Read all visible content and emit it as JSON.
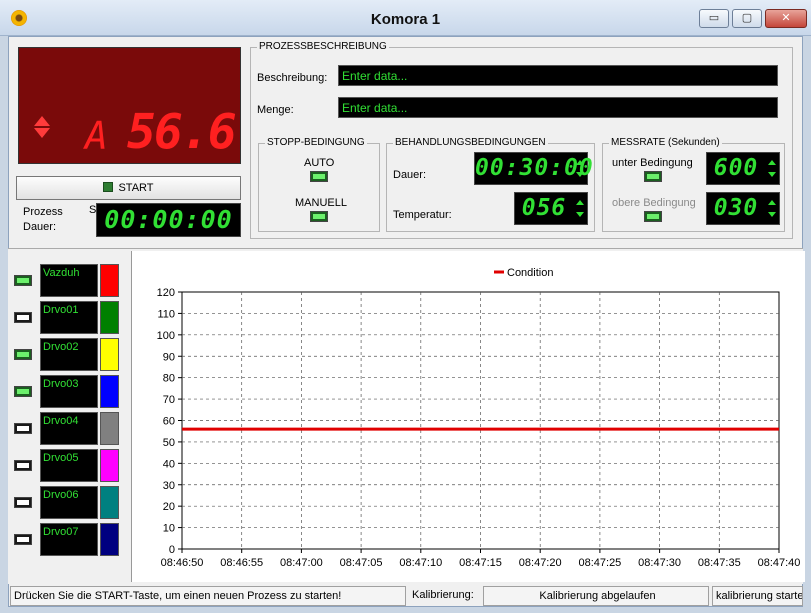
{
  "window": {
    "title": "Komora 1",
    "min_label": "▭",
    "max_label": "▢",
    "close_label": "✕"
  },
  "led": {
    "mode": "A",
    "value": "56.6"
  },
  "start_button": {
    "label": "START"
  },
  "prozess": {
    "label_line1": "Prozess",
    "label_line2": "Dauer:",
    "s_label": "S",
    "time": "00:00:00"
  },
  "prozessbeschreibung": {
    "legend": "PROZESSBESCHREIBUNG",
    "beschreibung_label": "Beschreibung:",
    "beschreibung_placeholder": "Enter data...",
    "menge_label": "Menge:",
    "menge_placeholder": "Enter data..."
  },
  "stopp": {
    "legend": "STOPP-BEDINGUNG",
    "auto_label": "AUTO",
    "manuell_label": "MANUELL"
  },
  "behandlung": {
    "legend": "BEHANDLUNGSBEDINGUNGEN",
    "dauer_label": "Dauer:",
    "dauer_value": "00:30:00",
    "temperatur_label": "Temperatur:",
    "temperatur_value": "056"
  },
  "messrate": {
    "legend": "MESSRATE (Sekunden)",
    "unter_label": "unter Bedingung",
    "unter_value": "600",
    "obere_label": "obere Bedingung",
    "obere_value": "030"
  },
  "series_list": [
    {
      "name": "Vazduh",
      "color": "#ff0000",
      "enabled": true
    },
    {
      "name": "Drvo01",
      "color": "#008000",
      "enabled": false
    },
    {
      "name": "Drvo02",
      "color": "#ffff00",
      "enabled": true
    },
    {
      "name": "Drvo03",
      "color": "#0000ff",
      "enabled": true
    },
    {
      "name": "Drvo04",
      "color": "#808080",
      "enabled": false
    },
    {
      "name": "Drvo05",
      "color": "#ff00ff",
      "enabled": false
    },
    {
      "name": "Drvo06",
      "color": "#008080",
      "enabled": false
    },
    {
      "name": "Drvo07",
      "color": "#000080",
      "enabled": false
    }
  ],
  "chart_data": {
    "type": "line",
    "legend_position": "top-center",
    "grid": true,
    "ylim": [
      0,
      120
    ],
    "yticks": [
      "0",
      "10",
      "20",
      "30",
      "40",
      "50",
      "60",
      "70",
      "80",
      "90",
      "100",
      "110",
      "120"
    ],
    "xticks": [
      "08:46:50",
      "08:46:55",
      "08:47:00",
      "08:47:05",
      "08:47:10",
      "08:47:15",
      "08:47:20",
      "08:47:25",
      "08:47:30",
      "08:47:35",
      "08:47:40"
    ],
    "series": [
      {
        "name": "Condition",
        "color": "#e00000",
        "x": [
          "08:46:50",
          "08:47:40"
        ],
        "values": [
          56,
          56
        ]
      }
    ]
  },
  "status": {
    "message": "Drücken Sie die START-Taste, um einen neuen Prozess zu starten!",
    "kalibrierung_label": "Kalibrierung:",
    "kalibrierung_value": "Kalibrierung abgelaufen",
    "kalibrierung_button": "kalibrierung starten"
  }
}
